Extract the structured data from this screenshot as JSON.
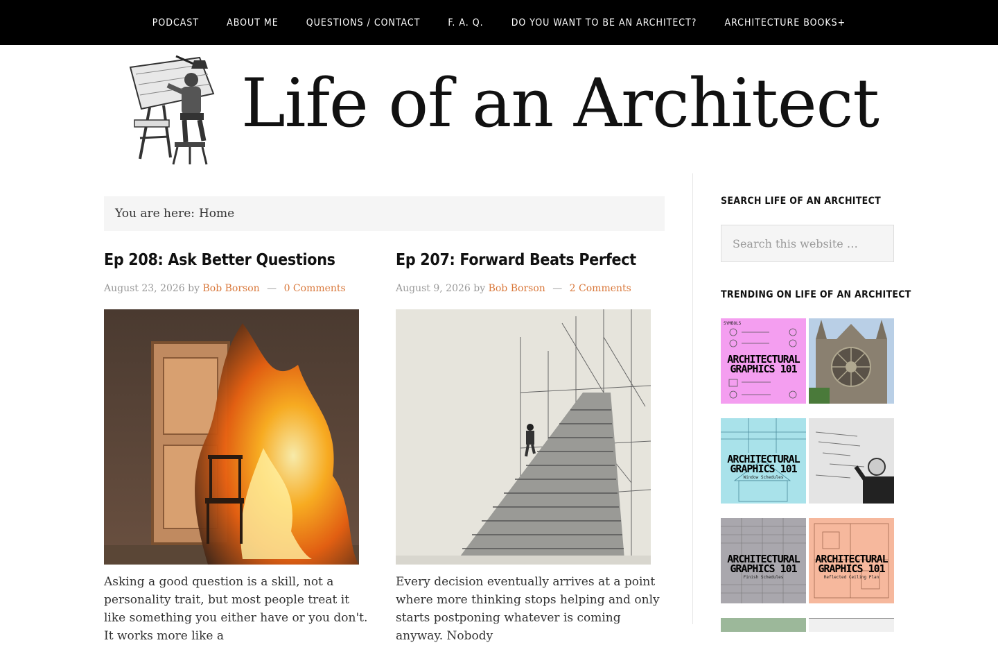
{
  "nav": {
    "items": [
      "Podcast",
      "About Me",
      "Questions / Contact",
      "F. A. Q.",
      "Do You Want to be an Architect?",
      "Architecture Books+"
    ]
  },
  "header": {
    "site_title": "Life of an Architect"
  },
  "breadcrumb": {
    "prefix": "You are here:",
    "current": "Home"
  },
  "posts": [
    {
      "title": "Ep 208: Ask Better Questions",
      "date": "August 23, 2026",
      "by": "by",
      "author": "Bob Borson",
      "comments": "0 Comments",
      "excerpt": "Asking a good question is a skill, not a personality trait, but most people treat it like something you either have or you don't. It works more like a"
    },
    {
      "title": "Ep 207: Forward Beats Perfect",
      "date": "August 9, 2026",
      "by": "by",
      "author": "Bob Borson",
      "comments": "2 Comments",
      "excerpt": "Every decision eventually arrives at a point where more thinking stops helping and only starts postponing whatever is coming anyway. Nobody"
    }
  ],
  "sidebar": {
    "search_title": "Search Life of an Architect",
    "search_placeholder": "Search this website …",
    "trending_title": "Trending on Life of an Architect",
    "thumbs": [
      {
        "label": "ARCHITECTURAL GRAPHICS 101",
        "sub": "SYMBOLS",
        "color": "#f49ef0"
      },
      {
        "label": "",
        "sub": "",
        "color": "#b9cfe6"
      },
      {
        "label": "ARCHITECTURAL GRAPHICS 101",
        "sub": "Window Schedules",
        "color": "#a9e2ea"
      },
      {
        "label": "",
        "sub": "",
        "color": "#e4e4e4"
      },
      {
        "label": "ARCHITECTURAL GRAPHICS 101",
        "sub": "Finish Schedules",
        "color": "#a9a7ad"
      },
      {
        "label": "ARCHITECTURAL GRAPHICS 101",
        "sub": "Reflected Ceiling Plan",
        "color": "#f6b89d"
      }
    ]
  },
  "colors": {
    "nav_bg": "#000000",
    "link": "#d9783b",
    "breadcrumb_bg": "#f5f5f5"
  }
}
